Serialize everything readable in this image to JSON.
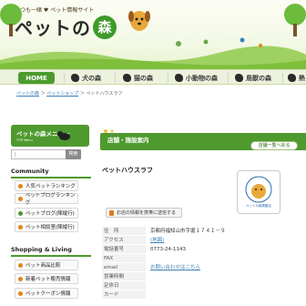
{
  "header": {
    "tagline": "いつも一緒 ♥ ペット情報サイト",
    "logo_text": "ペットの",
    "logo_mori": "森"
  },
  "nav": {
    "items": [
      {
        "label": "HOME"
      },
      {
        "label": "犬の森"
      },
      {
        "label": "猫の森"
      },
      {
        "label": "小動物の森"
      },
      {
        "label": "鳥獣の森"
      },
      {
        "label": "熱"
      }
    ]
  },
  "breadcrumb": {
    "home": "ペットの森",
    "section": "ペットショップ",
    "current": "ペットハウスラフ"
  },
  "sidebar": {
    "menu_title": "ペットの森メニュー",
    "menu_sub": "TOP Menu",
    "search_button": "検索",
    "community_title": "Community",
    "community_items": [
      "人気ペットランキング",
      "ペットブログランキング",
      "ペットブログ(陣縦行)",
      "ペット相談室(陣縦行)"
    ],
    "shopping_title": "Shopping & Living",
    "shopping_items": [
      "ペット商品比較",
      "新着ペット販売情報",
      "ペットクーポン情報"
    ]
  },
  "main": {
    "section_title": "店舗・施設案内",
    "list_button": "店舗一覧へ戻る",
    "shop_name": "ペットハウスラフ",
    "thumb_caption": "ペットの森掲載店",
    "phone_button": "お店の情報を携帯に送信する",
    "info_rows": [
      {
        "label": "住　所",
        "value": "京都府福知山市字堀１７４１－９",
        "link": false
      },
      {
        "label": "アクセス",
        "value": "(地図)",
        "link": true
      },
      {
        "label": "電話番号",
        "value": "0773-24-1143",
        "link": false
      },
      {
        "label": "FAX",
        "value": "",
        "link": false
      },
      {
        "label": "email",
        "value": "お問い合わせはこちら",
        "link": true
      },
      {
        "label": "営業時間",
        "value": "",
        "link": false
      },
      {
        "label": "定休日",
        "value": "",
        "link": false
      },
      {
        "label": "カード",
        "value": "",
        "link": false
      }
    ]
  },
  "colors": {
    "brand_green": "#4e9a2e",
    "link_blue": "#3e7fb8",
    "accent_orange": "#e0851c"
  }
}
